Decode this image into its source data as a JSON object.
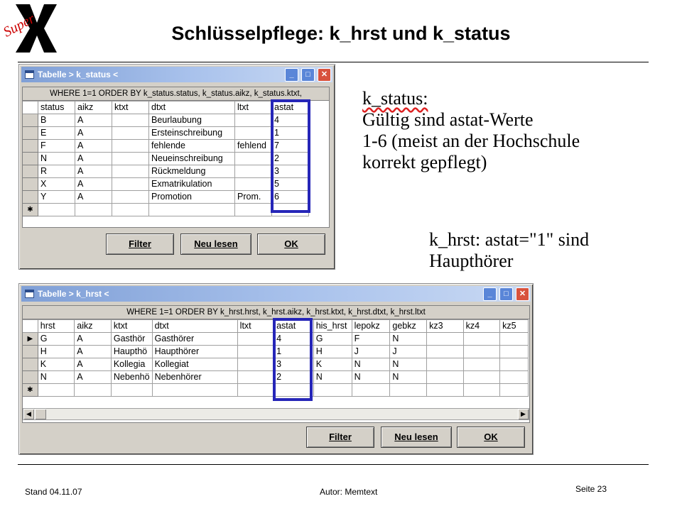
{
  "logo": {
    "script_text": "Super"
  },
  "title": "Schlüsselpflege: k_hrst und k_status",
  "win1": {
    "title": "Tabelle > k_status <",
    "query": "WHERE 1=1  ORDER BY  k_status.status, k_status.aikz, k_status.ktxt,",
    "columns": [
      "status",
      "aikz",
      "ktxt",
      "dtxt",
      "ltxt",
      "astat"
    ],
    "rows": [
      [
        "B",
        "A",
        "",
        "Beurlaubung",
        "",
        "4"
      ],
      [
        "E",
        "A",
        "",
        "Ersteinschreibung",
        "",
        "1"
      ],
      [
        "F",
        "A",
        "",
        "fehlende",
        "fehlend",
        "7"
      ],
      [
        "N",
        "A",
        "",
        "Neueinschreibung",
        "",
        "2"
      ],
      [
        "R",
        "A",
        "",
        "Rückmeldung",
        "",
        "3"
      ],
      [
        "X",
        "A",
        "",
        "Exmatrikulation",
        "",
        "5"
      ],
      [
        "Y",
        "A",
        "",
        "Promotion",
        "Prom.",
        "6"
      ]
    ],
    "buttons": {
      "filter": "Filter",
      "reload": "Neu lesen",
      "ok": "OK"
    }
  },
  "win2": {
    "title": "Tabelle > k_hrst <",
    "query": "WHERE 1=1  ORDER BY  k_hrst.hrst, k_hrst.aikz, k_hrst.ktxt, k_hrst.dtxt, k_hrst.ltxt",
    "columns": [
      "hrst",
      "aikz",
      "ktxt",
      "dtxt",
      "ltxt",
      "astat",
      "his_hrst",
      "lepokz",
      "gebkz",
      "kz3",
      "kz4",
      "kz5"
    ],
    "rows": [
      [
        "G",
        "A",
        "Gasthör",
        "Gasthörer",
        "",
        "4",
        "G",
        "F",
        "N",
        "",
        "",
        ""
      ],
      [
        "H",
        "A",
        "Haupthö",
        "Haupthörer",
        "",
        "1",
        "H",
        "J",
        "J",
        "",
        "",
        ""
      ],
      [
        "K",
        "A",
        "Kollegia",
        "Kollegiat",
        "",
        "3",
        "K",
        "N",
        "N",
        "",
        "",
        ""
      ],
      [
        "N",
        "A",
        "Nebenhö",
        "Nebenhörer",
        "",
        "2",
        "N",
        "N",
        "N",
        "",
        "",
        ""
      ]
    ],
    "buttons": {
      "filter": "Filter",
      "reload": "Neu lesen",
      "ok": "OK"
    }
  },
  "text_status": {
    "line1": "k_status:",
    "line2": "Gültig sind astat-Werte",
    "line3": "1-6 (meist an der Hochschule",
    "line4": "korrekt gepflegt)"
  },
  "text_hrst": {
    "line1": "k_hrst: astat=\"1\" sind",
    "line2": "Haupthörer"
  },
  "footer": {
    "left": "Stand 04.11.07",
    "center": "Autor: Memtext",
    "right": "Seite 23"
  },
  "glyphs": {
    "minimize": "_",
    "maximize": "□",
    "close": "✕",
    "row_pointer": "▶",
    "new_row": "✱",
    "arrow_left": "◀",
    "arrow_right": "▶"
  },
  "colors": {
    "highlight": "#2626b8",
    "titlebar": "#7f9fd6"
  }
}
